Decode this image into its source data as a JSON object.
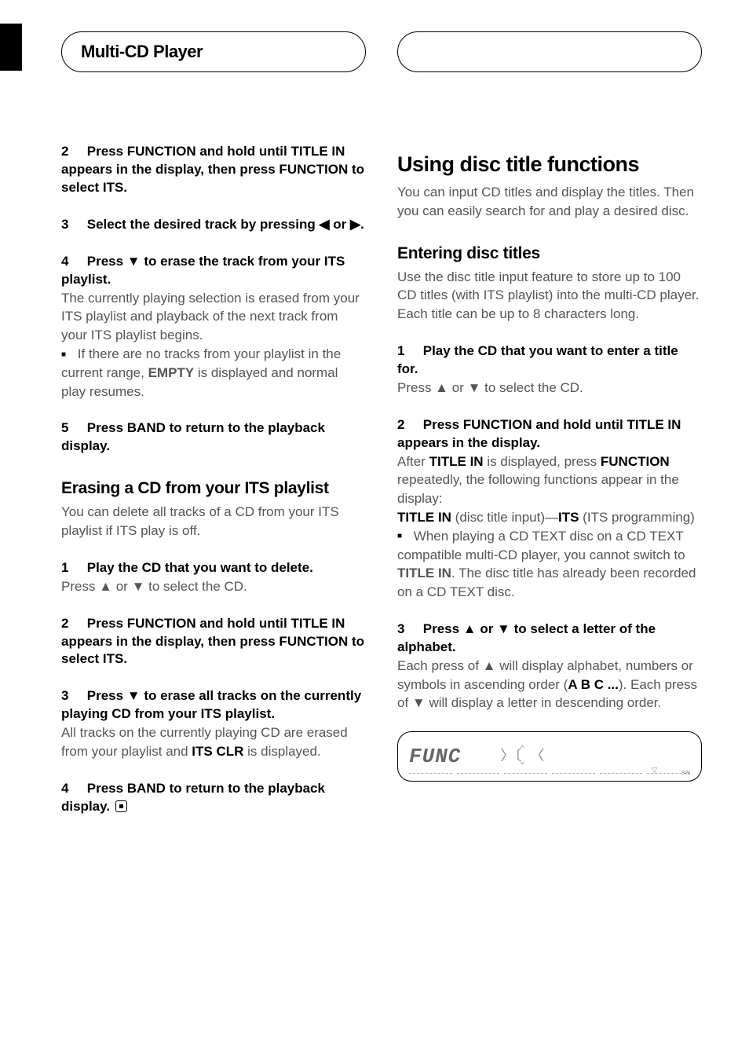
{
  "header": {
    "tab_left": "Multi-CD Player",
    "tab_right": ""
  },
  "left_col": {
    "steps_a": [
      {
        "num": "2",
        "head": "Press FUNCTION and hold until TITLE IN appears in the display, then press FUNCTION to select ITS."
      },
      {
        "num": "3",
        "head": "Select the desired track by pressing ◀ or ▶."
      },
      {
        "num": "4",
        "head": "Press ▼ to erase the track from your ITS playlist.",
        "body": "The currently playing selection is erased from your ITS playlist and playback of the next track from your ITS playlist begins.",
        "note_pre": "If there are no tracks from your playlist in the current range, ",
        "note_bold": "EMPTY",
        "note_post": " is displayed and normal play resumes."
      },
      {
        "num": "5",
        "head": "Press BAND to return to the playback display."
      }
    ],
    "subheading": "Erasing a CD from your ITS playlist",
    "sub_intro": "You can delete all tracks of a CD from your ITS playlist if ITS play is off.",
    "steps_b": [
      {
        "num": "1",
        "head": "Play the CD that you want to delete.",
        "body": "Press ▲ or ▼ to select the CD."
      },
      {
        "num": "2",
        "head": "Press FUNCTION and hold until TITLE IN appears in the display, then press FUNCTION to select ITS."
      },
      {
        "num": "3",
        "head": "Press ▼ to erase all tracks on the currently playing CD from your ITS playlist.",
        "body_pre": "All tracks on the currently playing CD are erased from your playlist and ",
        "body_bold": "ITS CLR",
        "body_post": " is displayed."
      },
      {
        "num": "4",
        "head": "Press BAND to return to the playback display.",
        "end": true
      }
    ]
  },
  "right_col": {
    "heading": "Using disc title functions",
    "intro": "You can input CD titles and display the titles. Then you can easily search for and play a desired disc.",
    "sub1": "Entering disc titles",
    "sub1_intro": "Use the disc title input feature to store up to 100 CD titles  (with ITS playlist) into the multi-CD player. Each title can be up to 8 characters long.",
    "steps": [
      {
        "num": "1",
        "head": "Play the CD that you want to enter a title for.",
        "body": "Press ▲ or ▼ to select the CD."
      },
      {
        "num": "2",
        "head": "Press FUNCTION and hold until TITLE IN appears in the display.",
        "body1_pre": "After ",
        "body1_b1": "TITLE IN",
        "body1_mid": " is displayed, press ",
        "body1_b2": "FUNCTION",
        "body1_post": " repeatedly, the following functions appear in the display:",
        "body2_b1": "TITLE IN",
        "body2_mid": " (disc title input)—",
        "body2_b2": "ITS",
        "body2_post": " (ITS programming)",
        "note_pre": "When playing a CD TEXT disc on a CD TEXT compatible multi-CD player, you cannot switch to ",
        "note_bold": "TITLE IN",
        "note_post": ". The disc title has already been recorded on a CD TEXT disc."
      },
      {
        "num": "3",
        "head": "Press ▲ or ▼ to select a letter of the alphabet.",
        "body_pre": "Each press of ▲ will display alphabet, numbers or symbols in ascending order (",
        "body_bold": "A B C ...",
        "body_post": "). Each press of ▼ will display a letter in descending order."
      }
    ],
    "lcd": {
      "text": "FUNC",
      "sw": "sw"
    }
  }
}
